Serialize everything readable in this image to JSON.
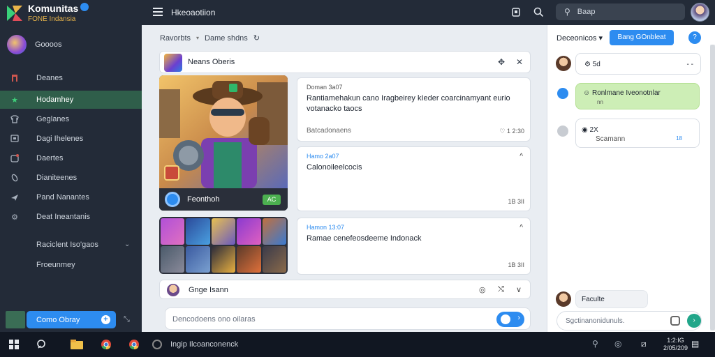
{
  "app": {
    "name": "Komunitas",
    "subtitle": "FONE Indansia"
  },
  "topbar": {
    "page_title": "Hkeoaotiion",
    "search_placeholder": "Baap"
  },
  "sidebar": {
    "profile_name": "Goooos",
    "items": [
      {
        "label": "Deanes",
        "icon": "home-icon"
      },
      {
        "label": "Hodamhey",
        "icon": "star-icon",
        "active": true
      },
      {
        "label": "Geglanes",
        "icon": "shirt-icon"
      },
      {
        "label": "Dagi Ihelenes",
        "icon": "chat-icon"
      },
      {
        "label": "Daertes",
        "icon": "badge-icon"
      },
      {
        "label": "Dianiteenes",
        "icon": "leaf-icon"
      },
      {
        "label": "Pand Nanantes",
        "icon": "send-icon"
      },
      {
        "label": "Deat Ineantanis",
        "icon": "gear-icon"
      }
    ],
    "section_title": "Raciclent Iso'gaos",
    "section_item": "Froeunmey",
    "bottom_button": "Como Obray"
  },
  "main": {
    "breadcrumb": [
      "Ravorbts",
      "Dame shdns"
    ],
    "post": {
      "title": "Neans Oberis",
      "hero_label": "Feonthoh",
      "hero_tag": "AC"
    },
    "notifications": [
      {
        "meta": "Doman 3a07",
        "body": "Rantiamehakun cano Iragbeirey kIeder coarcinamyant eurio votanacko taocs",
        "foot": "Batcadonaens",
        "time": "1 2:30"
      },
      {
        "meta": "Hamo 2a07",
        "body": "Calonoileelcocis",
        "time": "1B 3II"
      },
      {
        "meta": "Hamon 13:07",
        "body": "Ramae cenefeosdeeme Indonack",
        "time": "1B 3II"
      }
    ],
    "commenter": {
      "name": "Gnge Isann"
    },
    "composer_placeholder": "Dencodoens ono oilaras"
  },
  "right_panel": {
    "title": "Deceonicos",
    "button": "Bang GOnbleat",
    "help": "?",
    "chats": [
      {
        "text": "5d",
        "extra": "- -"
      },
      {
        "text": "Ronlmane Iveonotnlar",
        "sub": "nn"
      },
      {
        "text": "2X",
        "sub": "Scamann",
        "count": "18"
      }
    ],
    "bottom_user": "Faculte",
    "input_placeholder": "Sgctinanonidunuls."
  },
  "taskbar": {
    "search_text": "Ingip Ilcoanconenck",
    "time": "1:2:IG",
    "date": "2/05/209"
  }
}
